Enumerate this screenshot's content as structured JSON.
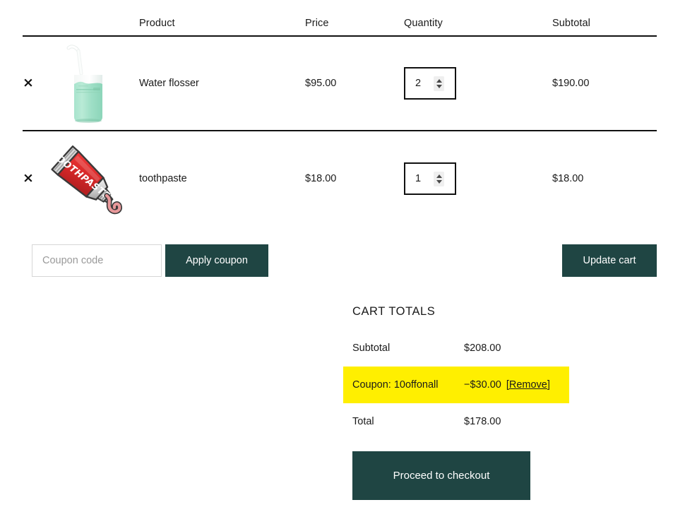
{
  "table": {
    "headers": {
      "remove": "",
      "thumbnail": "",
      "product": "Product",
      "price": "Price",
      "quantity": "Quantity",
      "subtotal": "Subtotal"
    },
    "rows": [
      {
        "remove_label": "×",
        "thumbnail": "water-flosser-image",
        "product": "Water flosser",
        "price": "$95.00",
        "quantity": "2",
        "subtotal": "$190.00"
      },
      {
        "remove_label": "×",
        "thumbnail": "toothpaste-image",
        "product": "toothpaste",
        "price": "$18.00",
        "quantity": "1",
        "subtotal": "$18.00"
      }
    ]
  },
  "coupon": {
    "placeholder": "Coupon code",
    "value": "",
    "apply_label": "Apply coupon",
    "update_label": "Update cart"
  },
  "totals": {
    "title": "CART TOTALS",
    "subtotal_label": "Subtotal",
    "subtotal_value": "$208.00",
    "coupon_label": "Coupon: 10offonall",
    "coupon_value": "−$30.00",
    "coupon_remove": "[Remove]",
    "total_label": "Total",
    "total_value": "$178.00",
    "checkout_label": "Proceed to checkout"
  },
  "colors": {
    "button": "#1f4543",
    "highlight": "#ffef00",
    "border": "#111111"
  }
}
